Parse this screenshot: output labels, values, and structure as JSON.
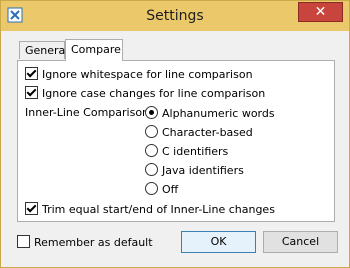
{
  "window": {
    "title": "Settings"
  },
  "tabs": [
    {
      "label": "General"
    },
    {
      "label": "Compare"
    }
  ],
  "compare": {
    "ignore_whitespace": {
      "label": "Ignore whitespace for line comparison",
      "checked": true
    },
    "ignore_case": {
      "label": "Ignore case changes for line comparison",
      "checked": true
    },
    "inner_line_label": "Inner-Line Comparison:",
    "inner_line_options": [
      {
        "label": "Alphanumeric words",
        "selected": true
      },
      {
        "label": "Character-based",
        "selected": false
      },
      {
        "label": "C identifiers",
        "selected": false
      },
      {
        "label": "Java identifiers",
        "selected": false
      },
      {
        "label": "Off",
        "selected": false
      }
    ],
    "trim_equal": {
      "label": "Trim equal start/end of Inner-Line changes",
      "checked": true
    }
  },
  "footer": {
    "remember_default": {
      "label": "Remember as default",
      "checked": false
    },
    "ok_label": "OK",
    "cancel_label": "Cancel"
  },
  "colors": {
    "titlebar": "#ebc86a",
    "close": "#c7453c"
  },
  "icons": {
    "app": "app-icon",
    "close": "close-icon"
  }
}
